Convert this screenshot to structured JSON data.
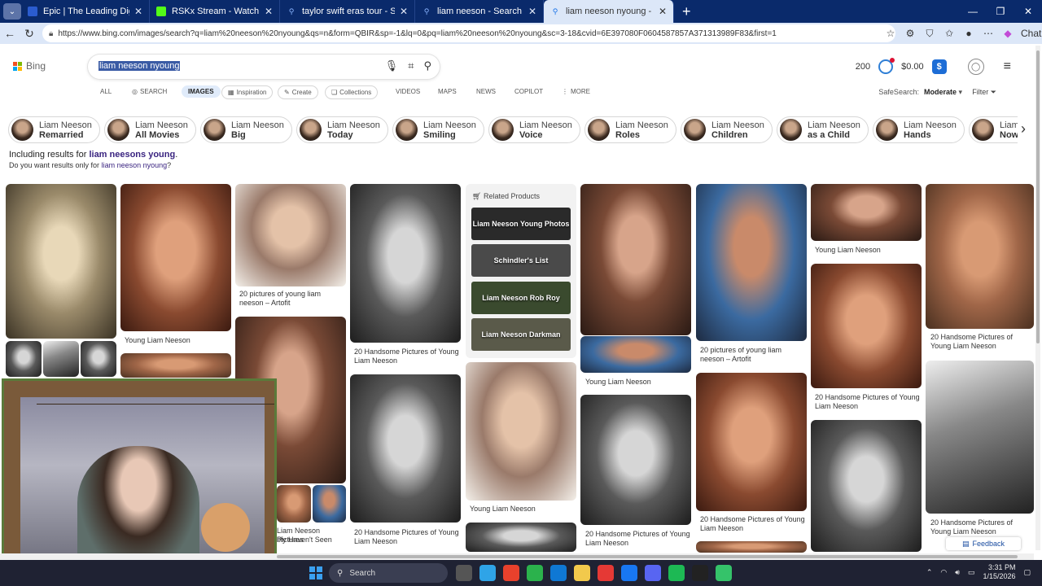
{
  "browser": {
    "tabs": [
      {
        "label": "Epic | The Leading Digital Library f",
        "color": "#2b5ccf"
      },
      {
        "label": "RSKx Stream - Watch Live on Kick",
        "color": "#53fc18"
      },
      {
        "label": "taylor swift eras tour - Search",
        "color": "#1a73e8"
      },
      {
        "label": "liam neeson - Search",
        "color": "#1a73e8"
      },
      {
        "label": "liam neeson nyoung - Search Imag",
        "color": "#1a73e8"
      }
    ],
    "url": "https://www.bing.com/images/search?q=liam%20neeson%20nyoung&qs=n&form=QBIR&sp=-1&lq=0&pq=liam%20neeson%20nyoung&sc=3-18&cvid=6E397080F0604587857A371313989F83&first=1",
    "chat_label": "Chat"
  },
  "header": {
    "logo": "Bing",
    "query": "liam neeson nyoung",
    "points": "200",
    "balance": "$0.00"
  },
  "scopes": [
    {
      "label": "ALL"
    },
    {
      "label": "SEARCH"
    },
    {
      "label": "IMAGES"
    },
    {
      "label": "Inspiration"
    },
    {
      "label": "Create"
    },
    {
      "label": "Collections"
    },
    {
      "label": "VIDEOS"
    },
    {
      "label": "MAPS"
    },
    {
      "label": "NEWS"
    },
    {
      "label": "COPILOT"
    },
    {
      "label": "MORE"
    }
  ],
  "safesearch": {
    "label": "SafeSearch:",
    "value": "Moderate"
  },
  "filter_label": "Filter",
  "chips": [
    {
      "line1": "Liam Neeson",
      "line2": "Remarried"
    },
    {
      "line1": "Liam Neeson",
      "line2": "All Movies"
    },
    {
      "line1": "Liam Neeson",
      "line2": "Big"
    },
    {
      "line1": "Liam Neeson",
      "line2": "Today"
    },
    {
      "line1": "Liam Neeson",
      "line2": "Smiling"
    },
    {
      "line1": "Liam Neeson",
      "line2": "Voice"
    },
    {
      "line1": "Liam Neeson",
      "line2": "Roles"
    },
    {
      "line1": "Liam Neeson",
      "line2": "Children"
    },
    {
      "line1": "Liam Neeson",
      "line2": "as a Child"
    },
    {
      "line1": "Liam Neeson",
      "line2": "Hands"
    },
    {
      "line1": "Liam",
      "line2": "Now"
    }
  ],
  "including": {
    "prefix": "Including results for",
    "term": "liam neesons young",
    "suffix": "."
  },
  "didyou": {
    "prefix": "Do you want results only for",
    "term": "liam neeson nyoung",
    "suffix": "?"
  },
  "captions": {
    "c1": "20 pictures of young liam neeson – Artofit",
    "c2": "Young Liam Neeson",
    "c3": "20 Handsome Pictures of Young Liam Neeson",
    "c4": "Young Liam Neeson",
    "c5": "20 pictures of young liam neeson – Artofit",
    "c6": "Young Liam Neeson",
    "c7": "20 Handsome Pictures of Young Liam Neeson",
    "c8": "20 Handsome Pictures of Young Liam Neeson",
    "c9": "Young Liam Neeson",
    "c10": "20 Handsome Pictures of Young Liam Neeson",
    "c11": "20 Handsome Pictures of Young Liam Neeson",
    "c12": "20 Handsome Pictures of Young Liam Neeson",
    "c13": "Liam Neeson Pictures",
    "c14": "bly Haven't Seen"
  },
  "related": {
    "title": "Related Products",
    "items": [
      "Liam Neeson Young Photos",
      "Schindler's List",
      "Liam Neeson Rob Roy",
      "Liam Neeson Darkman"
    ]
  },
  "feedback": "Feedback",
  "taskbar": {
    "search": "Search",
    "time": "3:31 PM",
    "date": "1/15/2026"
  }
}
